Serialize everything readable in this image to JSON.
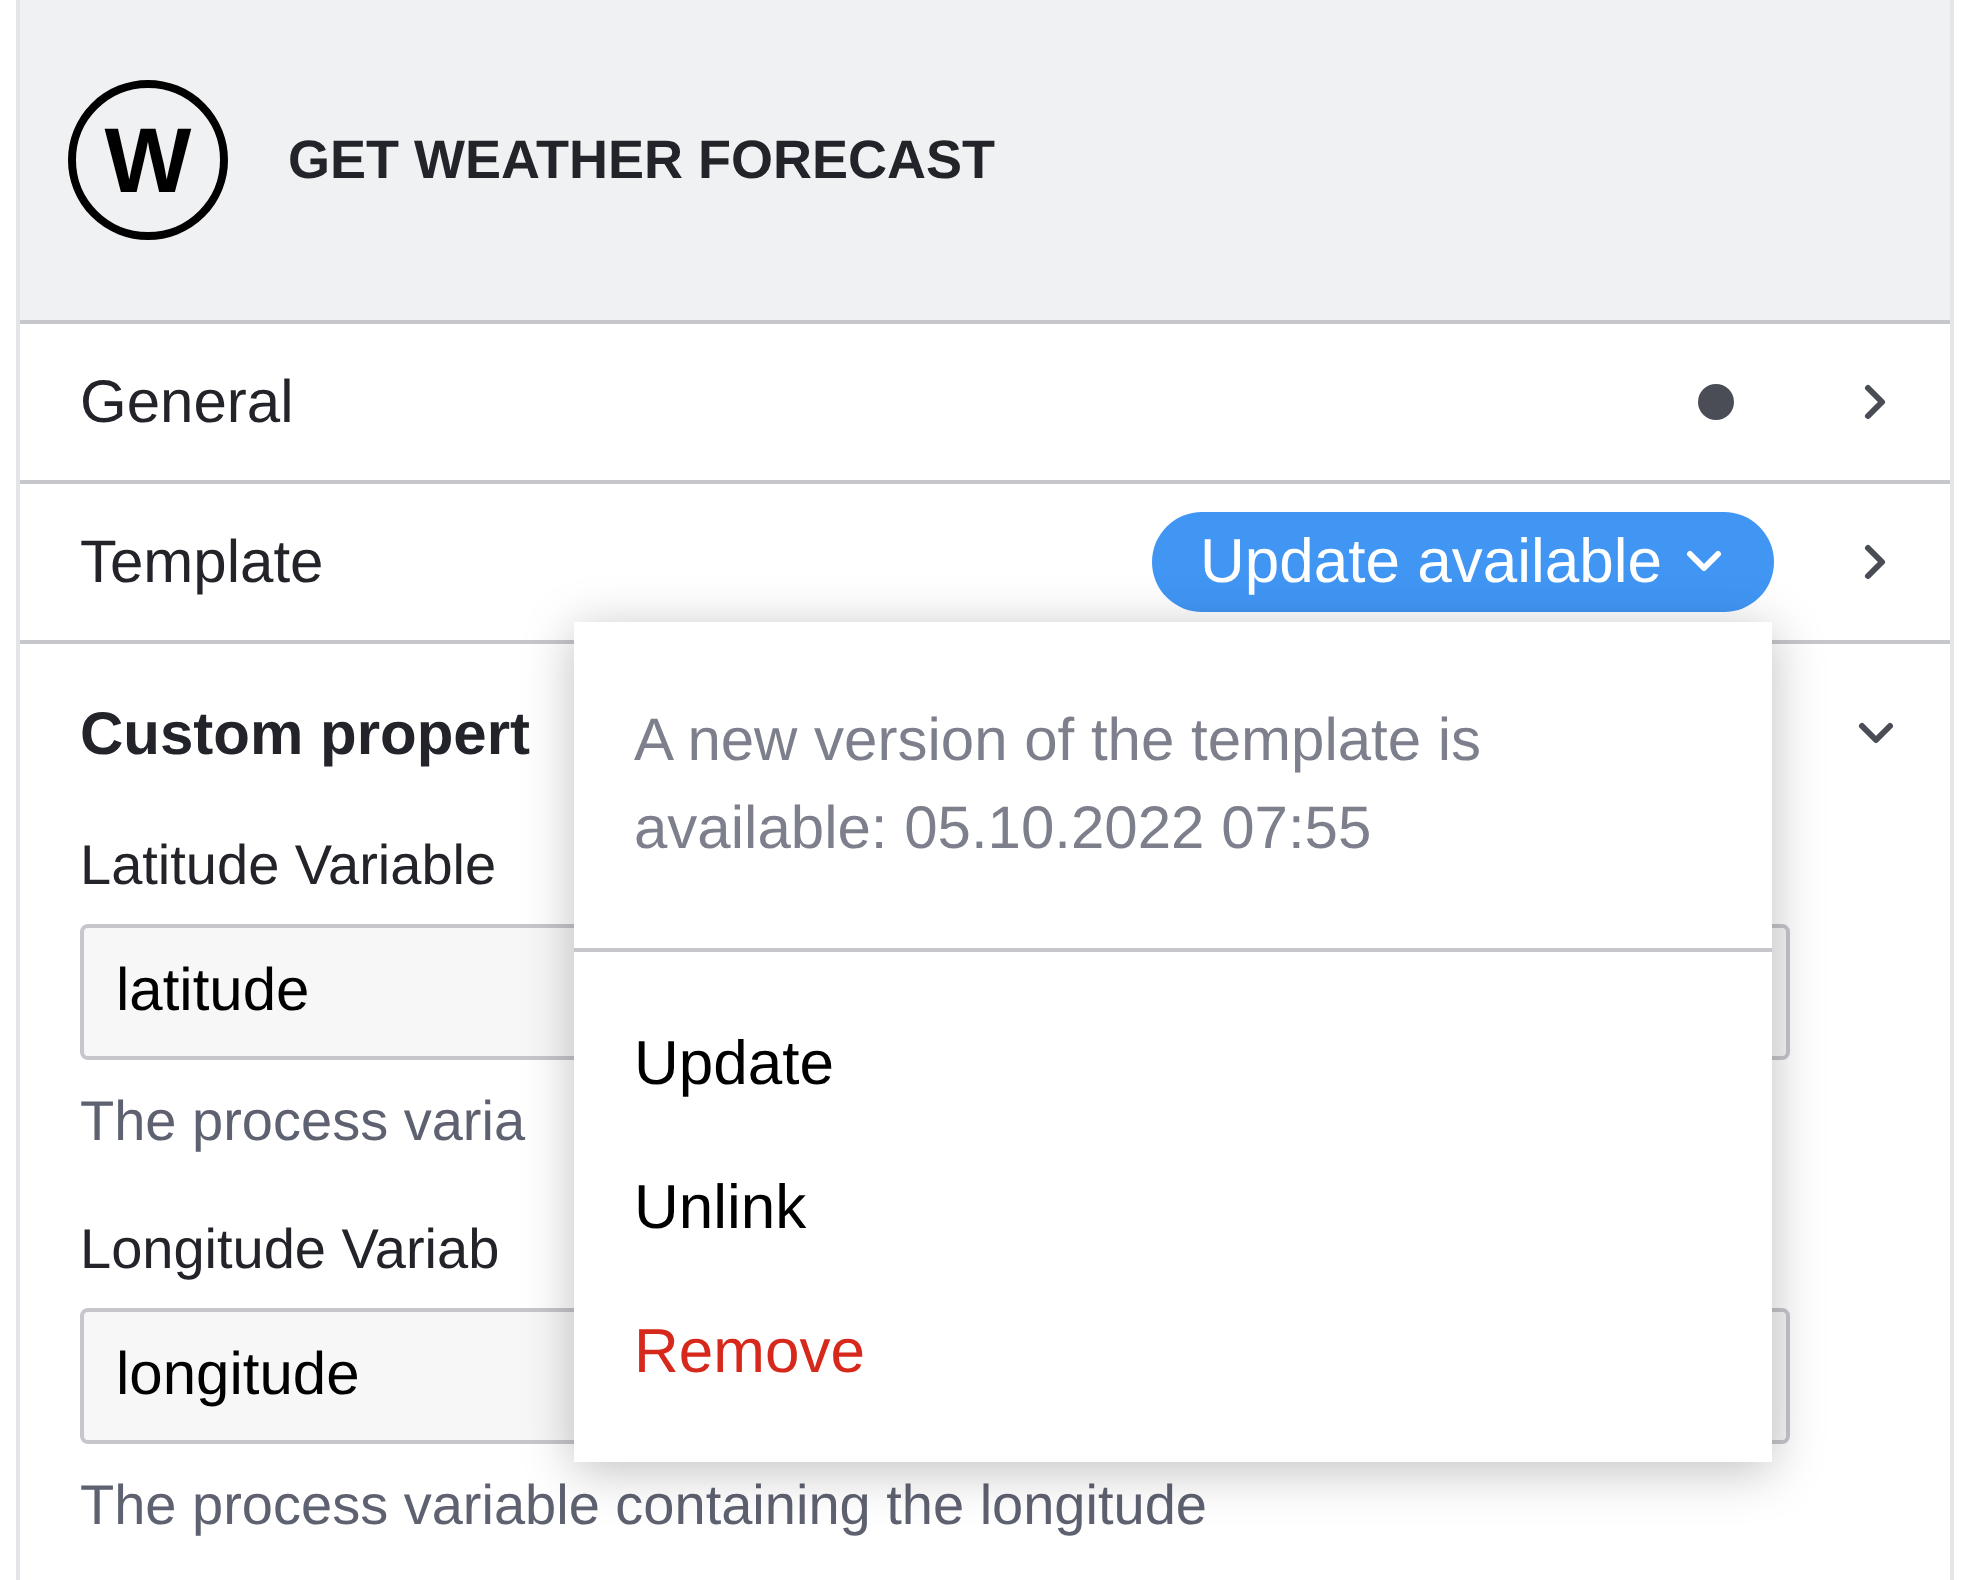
{
  "header": {
    "icon_letter": "W",
    "title": "GET WEATHER FORECAST"
  },
  "sections": [
    {
      "label": "General",
      "modified": true,
      "expanded": false
    },
    {
      "label": "Template",
      "badge": "Update available",
      "expanded": false
    },
    {
      "label": "Custom propert",
      "expanded": true,
      "fields": [
        {
          "label": "Latitude Variable",
          "value": "latitude",
          "description": "The process varia"
        },
        {
          "label": "Longitude Variab",
          "value": "longitude",
          "description": "The process variable containing the longitude"
        }
      ]
    }
  ],
  "popup": {
    "message": "A new version of the template is available: 05.10.2022 07:55",
    "items": [
      {
        "label": "Update",
        "kind": "action"
      },
      {
        "label": "Unlink",
        "kind": "action"
      },
      {
        "label": "Remove",
        "kind": "danger"
      }
    ]
  }
}
